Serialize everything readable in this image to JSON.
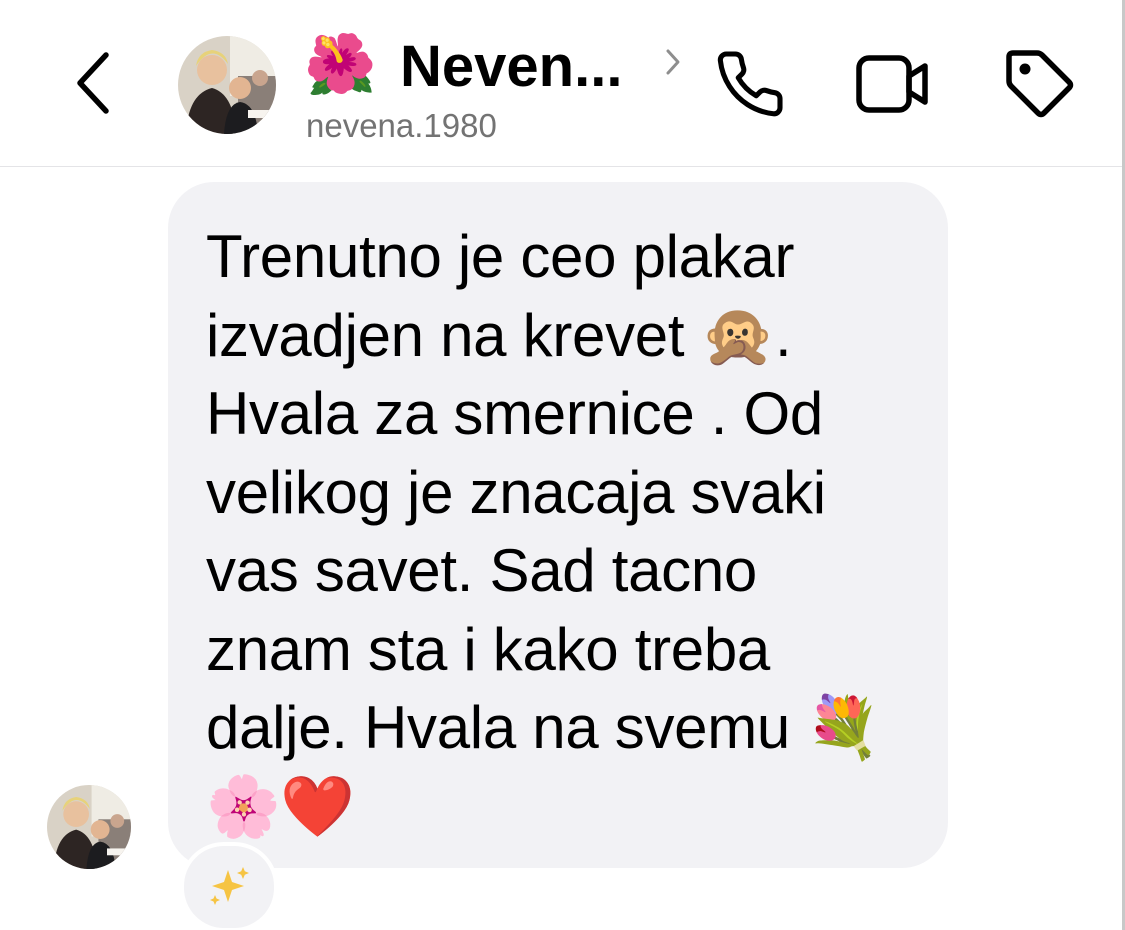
{
  "header": {
    "title_emoji": "🌺",
    "title": "Neven...",
    "username": "nevena.1980"
  },
  "icons": {
    "back": "chevron-left-icon",
    "title_chevron": "chevron-right-icon",
    "call": "phone-icon",
    "video": "video-camera-icon",
    "tag": "tag-icon",
    "reaction": "sparkles-icon"
  },
  "message": {
    "text": "Trenutno je ceo plakar\nizvadjen na krevet 🙊.\nHvala za smernice . Od\nvelikog je znacaja svaki\nvas savet. Sad tacno\nznam sta i kako treba\ndalje. Hvala na svemu 💐\n🌸❤️",
    "reaction": "✨"
  },
  "colors": {
    "bubble": "#f2f2f5",
    "secondary_text": "#737373",
    "divider": "#e4e4e7"
  }
}
